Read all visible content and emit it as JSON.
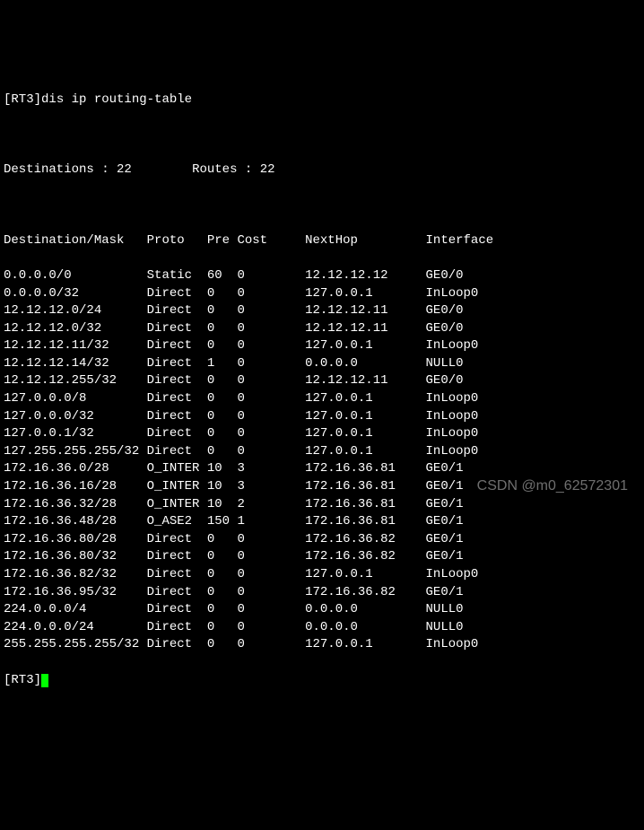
{
  "prompt_host": "[RT3]",
  "command": "dis ip routing-table",
  "summary": {
    "dest_label": "Destinations : ",
    "dest_count": "22",
    "routes_label": "Routes : ",
    "routes_count": "22"
  },
  "headers": {
    "dest": "Destination/Mask",
    "proto": "Proto",
    "pre": "Pre",
    "cost": "Cost",
    "nexthop": "NextHop",
    "iface": "Interface"
  },
  "rows": [
    {
      "dest": "0.0.0.0/0",
      "proto": "Static",
      "pre": "60",
      "cost": "0",
      "nexthop": "12.12.12.12",
      "iface": "GE0/0"
    },
    {
      "dest": "0.0.0.0/32",
      "proto": "Direct",
      "pre": "0",
      "cost": "0",
      "nexthop": "127.0.0.1",
      "iface": "InLoop0"
    },
    {
      "dest": "12.12.12.0/24",
      "proto": "Direct",
      "pre": "0",
      "cost": "0",
      "nexthop": "12.12.12.11",
      "iface": "GE0/0"
    },
    {
      "dest": "12.12.12.0/32",
      "proto": "Direct",
      "pre": "0",
      "cost": "0",
      "nexthop": "12.12.12.11",
      "iface": "GE0/0"
    },
    {
      "dest": "12.12.12.11/32",
      "proto": "Direct",
      "pre": "0",
      "cost": "0",
      "nexthop": "127.0.0.1",
      "iface": "InLoop0"
    },
    {
      "dest": "12.12.12.14/32",
      "proto": "Direct",
      "pre": "1",
      "cost": "0",
      "nexthop": "0.0.0.0",
      "iface": "NULL0"
    },
    {
      "dest": "12.12.12.255/32",
      "proto": "Direct",
      "pre": "0",
      "cost": "0",
      "nexthop": "12.12.12.11",
      "iface": "GE0/0"
    },
    {
      "dest": "127.0.0.0/8",
      "proto": "Direct",
      "pre": "0",
      "cost": "0",
      "nexthop": "127.0.0.1",
      "iface": "InLoop0"
    },
    {
      "dest": "127.0.0.0/32",
      "proto": "Direct",
      "pre": "0",
      "cost": "0",
      "nexthop": "127.0.0.1",
      "iface": "InLoop0"
    },
    {
      "dest": "127.0.0.1/32",
      "proto": "Direct",
      "pre": "0",
      "cost": "0",
      "nexthop": "127.0.0.1",
      "iface": "InLoop0"
    },
    {
      "dest": "127.255.255.255/32",
      "proto": "Direct",
      "pre": "0",
      "cost": "0",
      "nexthop": "127.0.0.1",
      "iface": "InLoop0"
    },
    {
      "dest": "172.16.36.0/28",
      "proto": "O_INTER",
      "pre": "10",
      "cost": "3",
      "nexthop": "172.16.36.81",
      "iface": "GE0/1"
    },
    {
      "dest": "172.16.36.16/28",
      "proto": "O_INTER",
      "pre": "10",
      "cost": "3",
      "nexthop": "172.16.36.81",
      "iface": "GE0/1"
    },
    {
      "dest": "172.16.36.32/28",
      "proto": "O_INTER",
      "pre": "10",
      "cost": "2",
      "nexthop": "172.16.36.81",
      "iface": "GE0/1"
    },
    {
      "dest": "172.16.36.48/28",
      "proto": "O_ASE2",
      "pre": "150",
      "cost": "1",
      "nexthop": "172.16.36.81",
      "iface": "GE0/1"
    },
    {
      "dest": "172.16.36.80/28",
      "proto": "Direct",
      "pre": "0",
      "cost": "0",
      "nexthop": "172.16.36.82",
      "iface": "GE0/1"
    },
    {
      "dest": "172.16.36.80/32",
      "proto": "Direct",
      "pre": "0",
      "cost": "0",
      "nexthop": "172.16.36.82",
      "iface": "GE0/1"
    },
    {
      "dest": "172.16.36.82/32",
      "proto": "Direct",
      "pre": "0",
      "cost": "0",
      "nexthop": "127.0.0.1",
      "iface": "InLoop0"
    },
    {
      "dest": "172.16.36.95/32",
      "proto": "Direct",
      "pre": "0",
      "cost": "0",
      "nexthop": "172.16.36.82",
      "iface": "GE0/1"
    },
    {
      "dest": "224.0.0.0/4",
      "proto": "Direct",
      "pre": "0",
      "cost": "0",
      "nexthop": "0.0.0.0",
      "iface": "NULL0"
    },
    {
      "dest": "224.0.0.0/24",
      "proto": "Direct",
      "pre": "0",
      "cost": "0",
      "nexthop": "0.0.0.0",
      "iface": "NULL0"
    },
    {
      "dest": "255.255.255.255/32",
      "proto": "Direct",
      "pre": "0",
      "cost": "0",
      "nexthop": "127.0.0.1",
      "iface": "InLoop0"
    }
  ],
  "prompt_end": "[RT3]",
  "watermark": "CSDN @m0_62572301"
}
